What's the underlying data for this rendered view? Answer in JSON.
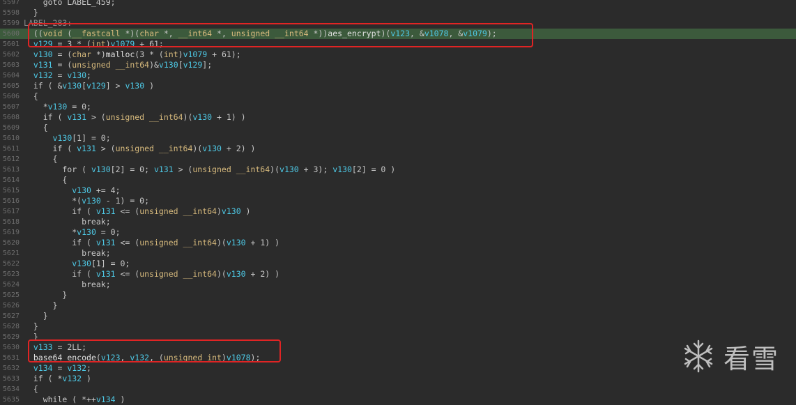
{
  "lines": [
    {
      "n": "5597",
      "tokens": [
        [
          "    goto LABEL_459;",
          "t-default"
        ]
      ]
    },
    {
      "n": "5598",
      "tokens": [
        [
          "  }",
          "t-default"
        ]
      ]
    },
    {
      "n": "5599",
      "tokens": [
        [
          "LABEL_283:",
          "t-label"
        ]
      ]
    },
    {
      "n": "5600",
      "highlight": true,
      "tokens": [
        [
          "  ((",
          "t-default"
        ],
        [
          "void",
          "t-type"
        ],
        [
          " (",
          "t-default"
        ],
        [
          "__fastcall",
          "t-type"
        ],
        [
          " *)(",
          "t-default"
        ],
        [
          "char",
          "t-type"
        ],
        [
          " *, ",
          "t-default"
        ],
        [
          "__int64",
          "t-type"
        ],
        [
          " *, ",
          "t-default"
        ],
        [
          "unsigned",
          "t-type"
        ],
        [
          " ",
          "t-default"
        ],
        [
          "__int64",
          "t-type"
        ],
        [
          " *))",
          "t-default"
        ],
        [
          "aes_encrypt",
          "t-fn"
        ],
        [
          ")(",
          "t-default"
        ],
        [
          "v123",
          "t-var"
        ],
        [
          ", &",
          "t-default"
        ],
        [
          "v1078",
          "t-var"
        ],
        [
          ", &",
          "t-default"
        ],
        [
          "v1079",
          "t-var"
        ],
        [
          ");",
          "t-default"
        ]
      ]
    },
    {
      "n": "5601",
      "tokens": [
        [
          "  ",
          "t-default"
        ],
        [
          "v129",
          "t-var"
        ],
        [
          " = 3 * (",
          "t-default"
        ],
        [
          "int",
          "t-type"
        ],
        [
          ")",
          "t-default"
        ],
        [
          "v1079",
          "t-var"
        ],
        [
          " + 61;",
          "t-default"
        ]
      ]
    },
    {
      "n": "5602",
      "tokens": [
        [
          "  ",
          "t-default"
        ],
        [
          "v130",
          "t-var"
        ],
        [
          " = (",
          "t-default"
        ],
        [
          "char",
          "t-type"
        ],
        [
          " *)",
          "t-default"
        ],
        [
          "malloc",
          "t-fn"
        ],
        [
          "(3 * (",
          "t-default"
        ],
        [
          "int",
          "t-type"
        ],
        [
          ")",
          "t-default"
        ],
        [
          "v1079",
          "t-var"
        ],
        [
          " + 61);",
          "t-default"
        ]
      ]
    },
    {
      "n": "5603",
      "tokens": [
        [
          "  ",
          "t-default"
        ],
        [
          "v131",
          "t-var"
        ],
        [
          " = (",
          "t-default"
        ],
        [
          "unsigned",
          "t-type"
        ],
        [
          " ",
          "t-default"
        ],
        [
          "__int64",
          "t-type"
        ],
        [
          ")&",
          "t-default"
        ],
        [
          "v130",
          "t-var"
        ],
        [
          "[",
          "t-default"
        ],
        [
          "v129",
          "t-var"
        ],
        [
          "];",
          "t-default"
        ]
      ]
    },
    {
      "n": "5604",
      "tokens": [
        [
          "  ",
          "t-default"
        ],
        [
          "v132",
          "t-var"
        ],
        [
          " = ",
          "t-default"
        ],
        [
          "v130",
          "t-var"
        ],
        [
          ";",
          "t-default"
        ]
      ]
    },
    {
      "n": "5605",
      "tokens": [
        [
          "  if ( &",
          "t-default"
        ],
        [
          "v130",
          "t-var"
        ],
        [
          "[",
          "t-default"
        ],
        [
          "v129",
          "t-var"
        ],
        [
          "] > ",
          "t-default"
        ],
        [
          "v130",
          "t-var"
        ],
        [
          " )",
          "t-default"
        ]
      ]
    },
    {
      "n": "5606",
      "tokens": [
        [
          "  {",
          "t-default"
        ]
      ]
    },
    {
      "n": "5607",
      "tokens": [
        [
          "    *",
          "t-default"
        ],
        [
          "v130",
          "t-var"
        ],
        [
          " = 0;",
          "t-default"
        ]
      ]
    },
    {
      "n": "5608",
      "tokens": [
        [
          "    if ( ",
          "t-default"
        ],
        [
          "v131",
          "t-var"
        ],
        [
          " > (",
          "t-default"
        ],
        [
          "unsigned",
          "t-type"
        ],
        [
          " ",
          "t-default"
        ],
        [
          "__int64",
          "t-type"
        ],
        [
          ")(",
          "t-default"
        ],
        [
          "v130",
          "t-var"
        ],
        [
          " + 1) )",
          "t-default"
        ]
      ]
    },
    {
      "n": "5609",
      "tokens": [
        [
          "    {",
          "t-default"
        ]
      ]
    },
    {
      "n": "5610",
      "tokens": [
        [
          "      ",
          "t-default"
        ],
        [
          "v130",
          "t-var"
        ],
        [
          "[1] = 0;",
          "t-default"
        ]
      ]
    },
    {
      "n": "5611",
      "tokens": [
        [
          "      if ( ",
          "t-default"
        ],
        [
          "v131",
          "t-var"
        ],
        [
          " > (",
          "t-default"
        ],
        [
          "unsigned",
          "t-type"
        ],
        [
          " ",
          "t-default"
        ],
        [
          "__int64",
          "t-type"
        ],
        [
          ")(",
          "t-default"
        ],
        [
          "v130",
          "t-var"
        ],
        [
          " + 2) )",
          "t-default"
        ]
      ]
    },
    {
      "n": "5612",
      "tokens": [
        [
          "      {",
          "t-default"
        ]
      ]
    },
    {
      "n": "5613",
      "tokens": [
        [
          "        for ( ",
          "t-default"
        ],
        [
          "v130",
          "t-var"
        ],
        [
          "[2] = 0; ",
          "t-default"
        ],
        [
          "v131",
          "t-var"
        ],
        [
          " > (",
          "t-default"
        ],
        [
          "unsigned",
          "t-type"
        ],
        [
          " ",
          "t-default"
        ],
        [
          "__int64",
          "t-type"
        ],
        [
          ")(",
          "t-default"
        ],
        [
          "v130",
          "t-var"
        ],
        [
          " + 3); ",
          "t-default"
        ],
        [
          "v130",
          "t-var"
        ],
        [
          "[2] = 0 )",
          "t-default"
        ]
      ]
    },
    {
      "n": "5614",
      "tokens": [
        [
          "        {",
          "t-default"
        ]
      ]
    },
    {
      "n": "5615",
      "tokens": [
        [
          "          ",
          "t-default"
        ],
        [
          "v130",
          "t-var"
        ],
        [
          " += 4;",
          "t-default"
        ]
      ]
    },
    {
      "n": "5616",
      "tokens": [
        [
          "          *(",
          "t-default"
        ],
        [
          "v130",
          "t-var"
        ],
        [
          " - 1) = 0;",
          "t-default"
        ]
      ]
    },
    {
      "n": "5617",
      "tokens": [
        [
          "          if ( ",
          "t-default"
        ],
        [
          "v131",
          "t-var"
        ],
        [
          " <= (",
          "t-default"
        ],
        [
          "unsigned",
          "t-type"
        ],
        [
          " ",
          "t-default"
        ],
        [
          "__int64",
          "t-type"
        ],
        [
          ")",
          "t-default"
        ],
        [
          "v130",
          "t-var"
        ],
        [
          " )",
          "t-default"
        ]
      ]
    },
    {
      "n": "5618",
      "tokens": [
        [
          "            break;",
          "t-default"
        ]
      ]
    },
    {
      "n": "5619",
      "tokens": [
        [
          "          *",
          "t-default"
        ],
        [
          "v130",
          "t-var"
        ],
        [
          " = 0;",
          "t-default"
        ]
      ]
    },
    {
      "n": "5620",
      "tokens": [
        [
          "          if ( ",
          "t-default"
        ],
        [
          "v131",
          "t-var"
        ],
        [
          " <= (",
          "t-default"
        ],
        [
          "unsigned",
          "t-type"
        ],
        [
          " ",
          "t-default"
        ],
        [
          "__int64",
          "t-type"
        ],
        [
          ")(",
          "t-default"
        ],
        [
          "v130",
          "t-var"
        ],
        [
          " + 1) )",
          "t-default"
        ]
      ]
    },
    {
      "n": "5621",
      "tokens": [
        [
          "            break;",
          "t-default"
        ]
      ]
    },
    {
      "n": "5622",
      "tokens": [
        [
          "          ",
          "t-default"
        ],
        [
          "v130",
          "t-var"
        ],
        [
          "[1] = 0;",
          "t-default"
        ]
      ]
    },
    {
      "n": "5623",
      "tokens": [
        [
          "          if ( ",
          "t-default"
        ],
        [
          "v131",
          "t-var"
        ],
        [
          " <= (",
          "t-default"
        ],
        [
          "unsigned",
          "t-type"
        ],
        [
          " ",
          "t-default"
        ],
        [
          "__int64",
          "t-type"
        ],
        [
          ")(",
          "t-default"
        ],
        [
          "v130",
          "t-var"
        ],
        [
          " + 2) )",
          "t-default"
        ]
      ]
    },
    {
      "n": "5624",
      "tokens": [
        [
          "            break;",
          "t-default"
        ]
      ]
    },
    {
      "n": "5625",
      "tokens": [
        [
          "        }",
          "t-default"
        ]
      ]
    },
    {
      "n": "5626",
      "tokens": [
        [
          "      }",
          "t-default"
        ]
      ]
    },
    {
      "n": "5627",
      "tokens": [
        [
          "    }",
          "t-default"
        ]
      ]
    },
    {
      "n": "5628",
      "tokens": [
        [
          "  }",
          "t-default"
        ]
      ]
    },
    {
      "n": "5629",
      "tokens": [
        [
          "  }",
          "t-default"
        ]
      ]
    },
    {
      "n": "5630",
      "tokens": [
        [
          "  ",
          "t-default"
        ],
        [
          "v133",
          "t-var"
        ],
        [
          " = 2LL;",
          "t-default"
        ]
      ]
    },
    {
      "n": "5631",
      "tokens": [
        [
          "  ",
          "t-default"
        ],
        [
          "base64_encode",
          "t-fn"
        ],
        [
          "(",
          "t-default"
        ],
        [
          "v123",
          "t-var"
        ],
        [
          ", ",
          "t-default"
        ],
        [
          "v132",
          "t-var"
        ],
        [
          ", (",
          "t-default"
        ],
        [
          "unsigned",
          "t-type"
        ],
        [
          " ",
          "t-default"
        ],
        [
          "int",
          "t-type"
        ],
        [
          ")",
          "t-default"
        ],
        [
          "v1078",
          "t-var"
        ],
        [
          ");",
          "t-default"
        ]
      ]
    },
    {
      "n": "5632",
      "tokens": [
        [
          "  ",
          "t-default"
        ],
        [
          "v134",
          "t-var"
        ],
        [
          " = ",
          "t-default"
        ],
        [
          "v132",
          "t-var"
        ],
        [
          ";",
          "t-default"
        ]
      ]
    },
    {
      "n": "5633",
      "tokens": [
        [
          "  if ( *",
          "t-default"
        ],
        [
          "v132",
          "t-var"
        ],
        [
          " )",
          "t-default"
        ]
      ]
    },
    {
      "n": "5634",
      "tokens": [
        [
          "  {",
          "t-default"
        ]
      ]
    },
    {
      "n": "5635",
      "tokens": [
        [
          "    while ( *++",
          "t-default"
        ],
        [
          "v134",
          "t-var"
        ],
        [
          " )",
          "t-default"
        ]
      ]
    }
  ],
  "watermark": {
    "text": "看雪",
    "icon": "snowflake-icon"
  }
}
